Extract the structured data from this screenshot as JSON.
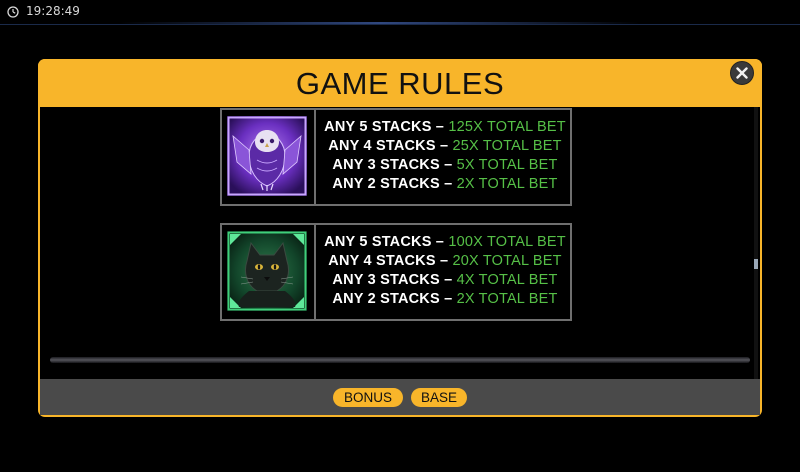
{
  "status_bar": {
    "time": "19:28:49",
    "clock_icon": "clock-icon"
  },
  "modal": {
    "title": "GAME RULES",
    "close_icon": "close-icon",
    "accent_color": "#f8b52a"
  },
  "paytables": [
    {
      "symbol": "owl-symbol",
      "symbol_color": "#7b3fd6",
      "pays": [
        {
          "label": "ANY 5 STACKS",
          "sep": " – ",
          "value": "125X TOTAL BET"
        },
        {
          "label": "ANY 4 STACKS",
          "sep": " – ",
          "value": "25X TOTAL BET"
        },
        {
          "label": "ANY 3 STACKS",
          "sep": " – ",
          "value": "5X TOTAL BET"
        },
        {
          "label": "ANY 2 STACKS",
          "sep": " – ",
          "value": "2X TOTAL BET"
        }
      ]
    },
    {
      "symbol": "panther-symbol",
      "symbol_color": "#1f8a4a",
      "pays": [
        {
          "label": "ANY 5 STACKS",
          "sep": " – ",
          "value": "100X TOTAL BET"
        },
        {
          "label": "ANY 4 STACKS",
          "sep": " – ",
          "value": "20X TOTAL BET"
        },
        {
          "label": "ANY 3 STACKS",
          "sep": " – ",
          "value": "4X TOTAL BET"
        },
        {
          "label": "ANY 2 STACKS",
          "sep": " – ",
          "value": "2X TOTAL BET"
        }
      ]
    }
  ],
  "footer": {
    "bonus_label": "BONUS",
    "base_label": "BASE"
  },
  "colors": {
    "pay_value": "#56c047",
    "footer_bg": "#4a4a4a"
  }
}
